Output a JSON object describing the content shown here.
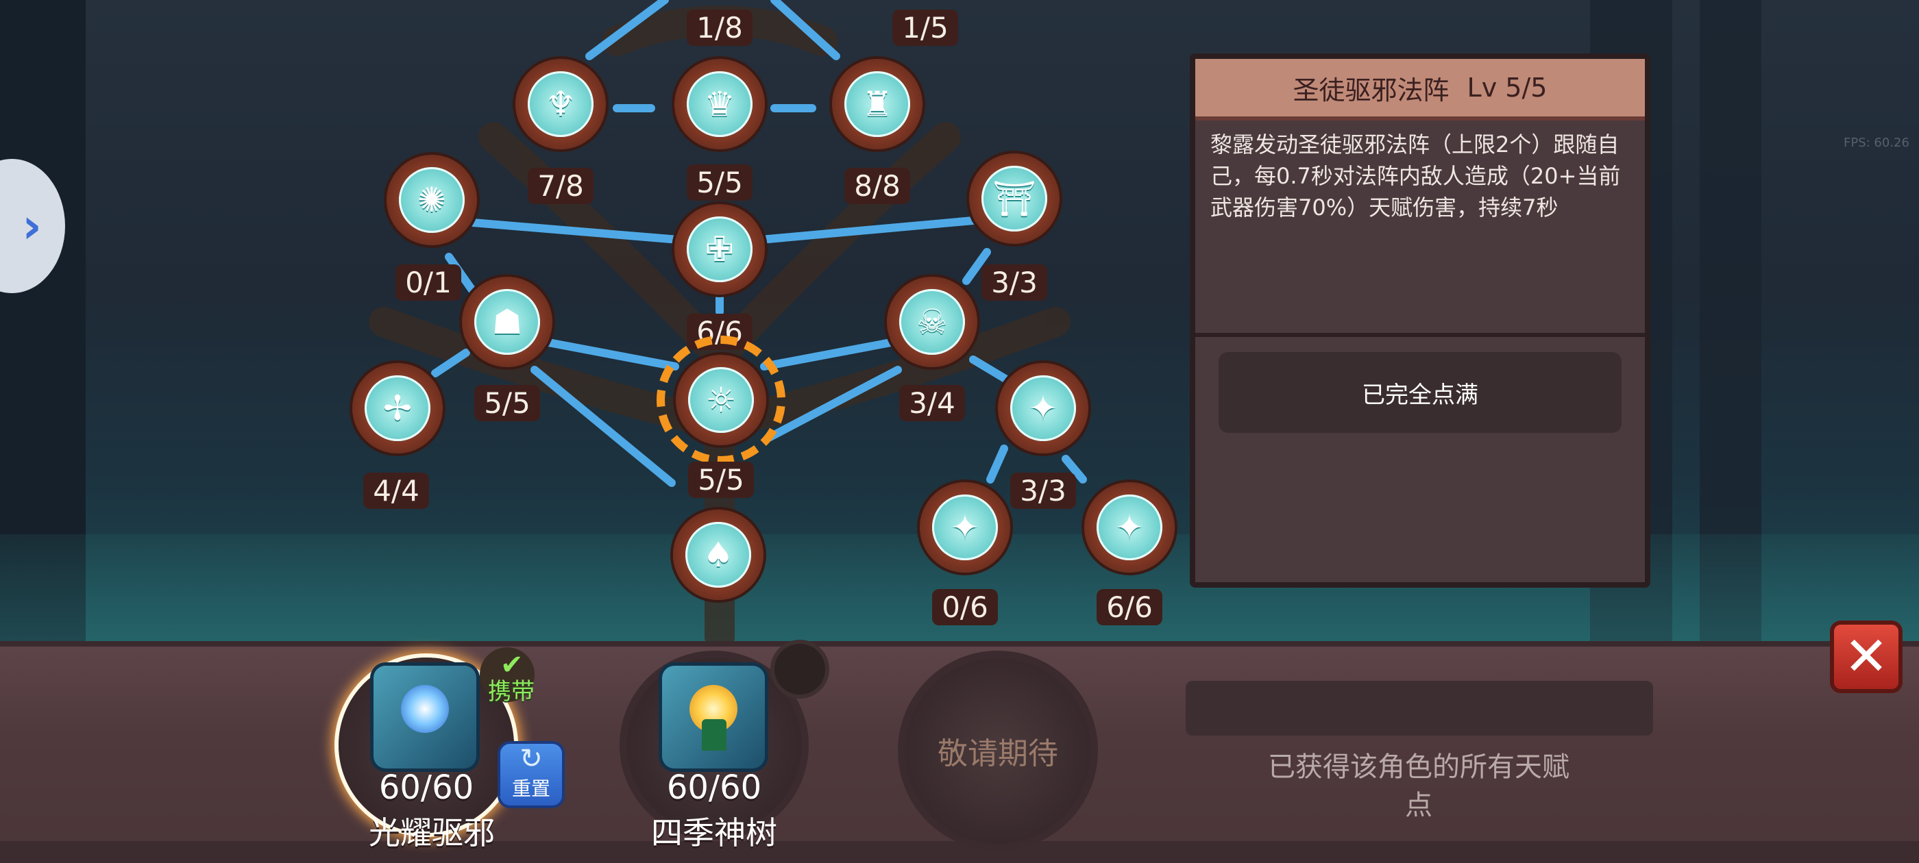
{
  "nav": {
    "prev_icon": "chevron-left-icon"
  },
  "fps": "FPS: 60.26",
  "talent_nodes": [
    {
      "id": "n-top-1",
      "level": "1/8",
      "icon": "relic-icon"
    },
    {
      "id": "n-top-2",
      "level": "1/5",
      "icon": "relic-icon"
    },
    {
      "id": "n-a",
      "level": "7/8",
      "icon": "angel-icon"
    },
    {
      "id": "n-b",
      "level": "5/5",
      "icon": "crown-icon"
    },
    {
      "id": "n-c",
      "level": "8/8",
      "icon": "guardian-icon"
    },
    {
      "id": "n-d",
      "level": "0/1",
      "icon": "spiral-icon"
    },
    {
      "id": "n-e",
      "level": "6/6",
      "icon": "priest-icon"
    },
    {
      "id": "n-f",
      "level": "3/3",
      "icon": "altar-icon"
    },
    {
      "id": "n-g",
      "level": "5/5",
      "icon": "shrine-icon"
    },
    {
      "id": "n-h",
      "level": "3/4",
      "icon": "skull-icon"
    },
    {
      "id": "n-i",
      "level": "4/4",
      "icon": "rune-icon"
    },
    {
      "id": "n-selected",
      "level": "5/5",
      "icon": "holy-circle-icon"
    },
    {
      "id": "n-j",
      "level": "3/3",
      "icon": "spark-icon"
    },
    {
      "id": "n-k",
      "level": "",
      "icon": "ghost-icon"
    },
    {
      "id": "n-l",
      "level": "0/6",
      "icon": "spark-icon"
    },
    {
      "id": "n-m",
      "level": "6/6",
      "icon": "spark-icon"
    }
  ],
  "panel": {
    "title": "圣徒驱邪法阵",
    "level": "Lv 5/5",
    "description": "黎露发动圣徒驱邪法阵（上限2个）跟随自己，每0.7秒对法阵内敌人造成（20+当前武器伤害70%）天赋伤害，持续7秒",
    "status_button": "已完全点满"
  },
  "books": [
    {
      "count": "60/60",
      "name": "光耀驱邪",
      "icon": "holy-book-icon"
    },
    {
      "count": "60/60",
      "name": "四季神树",
      "icon": "tree-book-icon"
    }
  ],
  "carry_label": "携带",
  "reset_label": "重置",
  "coming_soon": "敬请期待",
  "earned_text": "已获得该角色的所有天赋点",
  "colors": {
    "node_core": "#7fd9d6",
    "node_ring": "#7a3422",
    "selected_ring": "#f5961f",
    "link_line": "#4fa9e6"
  }
}
